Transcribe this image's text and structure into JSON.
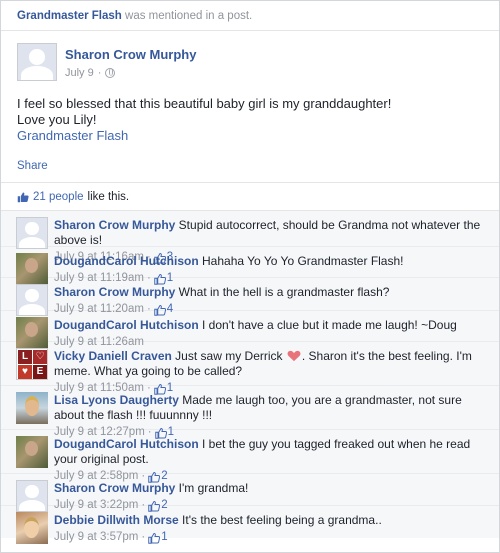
{
  "mention_bar": {
    "name": "Grandmaster Flash",
    "text": " was mentioned in a post."
  },
  "post": {
    "author": "Sharon Crow Murphy",
    "date": "July 9",
    "dot": "·",
    "line1": "I feel so blessed that this beautiful baby girl is my granddaughter!",
    "line2": "Love you Lily!",
    "tag": "Grandmaster Flash",
    "share_label": "Share"
  },
  "likes": {
    "count": "21 people",
    "suffix": " like this."
  },
  "comments": [
    {
      "author": "Sharon Crow Murphy",
      "text": " Stupid autocorrect, should be Grandma not whatever the above is!",
      "time": "July 9 at 11:16am",
      "likes": "3",
      "avatar": "silhouette"
    },
    {
      "author": "DougandCarol Hutchison",
      "text": " Hahaha Yo Yo Yo Grandmaster Flash!",
      "time": "July 9 at 11:19am",
      "likes": "1",
      "avatar": "photo-a"
    },
    {
      "author": "Sharon Crow Murphy",
      "text": " What in the hell is a grandmaster flash?",
      "time": "July 9 at 11:20am",
      "likes": "4",
      "avatar": "silhouette"
    },
    {
      "author": "DougandCarol Hutchison",
      "text": " I don't have a clue but it made me laugh! ~Doug",
      "time": "July 9 at 11:26am",
      "likes": "",
      "avatar": "photo-a"
    },
    {
      "author": "Vicky Daniell Craven",
      "text": " Just saw my Derrick ",
      "text_after": ". Sharon it's the best feeling. I'm meme. What ya going to be called?",
      "time": "July 9 at 11:50am",
      "likes": "1",
      "avatar": "love",
      "has_heart": true
    },
    {
      "author": "Lisa Lyons Daugherty",
      "text": " Made me laugh too, you are a grandmaster, not sure about the flash !!! fuuunnny !!!",
      "time": "July 9 at 12:27pm",
      "likes": "1",
      "avatar": "photo-b"
    },
    {
      "author": "DougandCarol Hutchison",
      "text": " I bet the guy you tagged freaked out when he read your original post.",
      "time": "July 9 at 2:58pm",
      "likes": "2",
      "avatar": "photo-a"
    },
    {
      "author": "Sharon Crow Murphy",
      "text": " I'm grandma!",
      "time": "July 9 at 3:22pm",
      "likes": "2",
      "avatar": "silhouette"
    },
    {
      "author": "Debbie Dillwith Morse",
      "text": " It's the best feeling being a grandma..",
      "time": "July 9 at 3:57pm",
      "likes": "1",
      "avatar": "photo-c"
    }
  ],
  "avatar_love_letters": [
    "L",
    "♡",
    "♥",
    "E"
  ],
  "colors": {
    "link_blue": "#365899",
    "like_blue": "#4267b2",
    "meta_gray": "#90949c",
    "comment_bg": "#f6f7f9",
    "heart_red": "#e9737b"
  }
}
